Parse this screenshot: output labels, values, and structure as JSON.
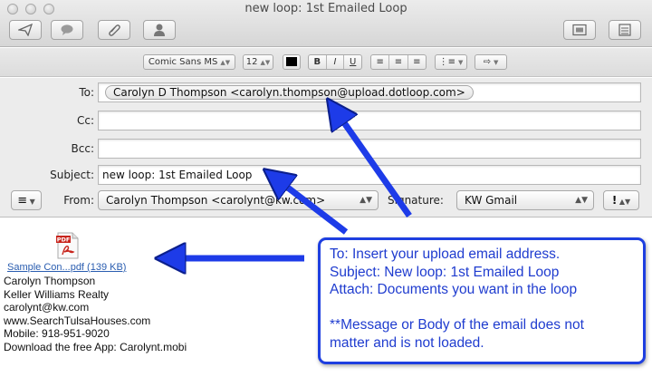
{
  "window": {
    "title": "new loop: 1st Emailed Loop"
  },
  "format_bar": {
    "font_family": "Comic Sans MS",
    "font_size": "12",
    "bold_label": "B",
    "italic_label": "I",
    "underline_label": "U"
  },
  "headers": {
    "to_label": "To:",
    "to_token": "Carolyn D Thompson <carolyn.thompson@upload.dotloop.com>",
    "cc_label": "Cc:",
    "bcc_label": "Bcc:",
    "subject_label": "Subject:",
    "subject_value": "new loop: 1st Emailed Loop",
    "from_label": "From:",
    "from_value": "Carolyn Thompson <carolynt@kw.com>",
    "signature_label": "Signature:",
    "signature_value": "KW Gmail"
  },
  "body": {
    "attachment_icon_text": "PDF",
    "attachment_link": "Sample Con...pdf (139 KB)",
    "signature_lines": [
      "Carolyn Thompson",
      "Keller Williams Realty",
      "carolynt@kw.com",
      "www.SearchTulsaHouses.com",
      "Mobile: 918-951-9020",
      "Download the free App: Carolynt.mobi"
    ]
  },
  "callout": {
    "lines": [
      "To: Insert your upload email address.",
      "Subject: New loop: 1st Emailed Loop",
      "Attach: Documents you want in the loop",
      "",
      "**Message or Body of the email does not",
      "matter and is not loaded."
    ]
  },
  "colors": {
    "annotation_blue": "#1f3ccf",
    "link_blue": "#2a5db0"
  }
}
